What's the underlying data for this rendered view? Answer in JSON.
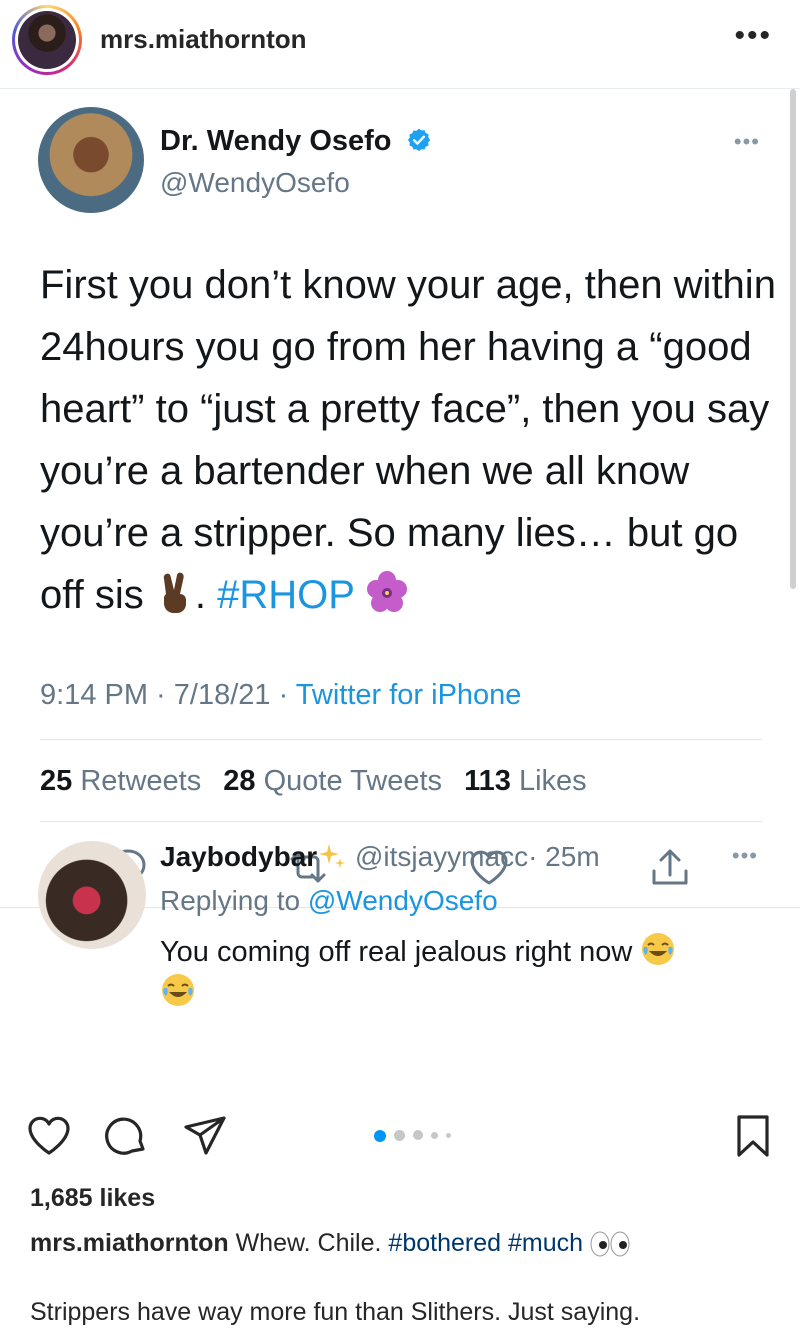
{
  "instagram": {
    "username": "mrs.miathornton",
    "more_icon": "ellipsis-icon",
    "likes": "1,685 likes",
    "caption": {
      "username": "mrs.miathornton",
      "text": "Whew. Chile.",
      "hashtags": [
        "#bothered",
        "#much"
      ],
      "second_line": "Strippers have way more fun than Slithers.  Just saying."
    },
    "carousel": {
      "count": 5,
      "active": 0
    }
  },
  "tweet": {
    "display_name": "Dr. Wendy Osefo",
    "handle": "@WendyOsefo",
    "text_main": "First you don’t know your age, then within 24hours you go from her having a “good heart” to “just a pretty face”, then you say you’re a bartender when we all know you’re a stripper. So many lies… but go off sis",
    "text_after_emoji": ". ",
    "hashtag": "#RHOP",
    "timestamp": "9:14 PM · 7/18/21 · ",
    "source": "Twitter for iPhone",
    "stats": {
      "retweets_count": "25",
      "retweets_label": "Retweets",
      "quotes_count": "28",
      "quotes_label": "Quote Tweets",
      "likes_count": "113",
      "likes_label": "Likes"
    }
  },
  "reply": {
    "display_name": "Jaybodybar",
    "handle": "@itsjayymacc",
    "time": "· 25m",
    "replying_prefix": "Replying to ",
    "replying_to": "@WendyOsefo",
    "text": "You coming off real jealous right now"
  },
  "colors": {
    "twitter_blue": "#1b95e0",
    "twitter_gray": "#657786",
    "instagram_text": "#262626",
    "instagram_tag": "#00376b"
  }
}
